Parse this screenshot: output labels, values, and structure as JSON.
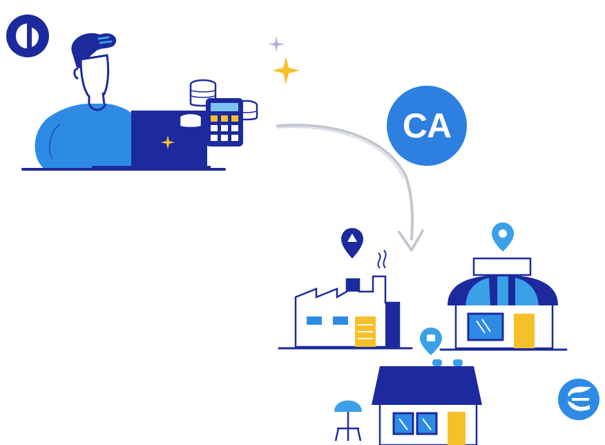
{
  "badge": {
    "text": "CA"
  },
  "colors": {
    "navy": "#1c2a9e",
    "blue": "#2d7fe0",
    "light_blue": "#3aa0e8",
    "yellow": "#f5c12b",
    "sparkle_purple": "#b9a8e8",
    "arrow_gray": "#c2c7cf"
  },
  "icons": [
    "brand-logo-top-left-icon",
    "person-at-laptop-illustration",
    "coins-stack-icon",
    "calculator-icon",
    "sparkle-star-icon",
    "curved-arrow-icon",
    "factory-illustration",
    "store-awning-illustration",
    "house-illustration",
    "location-pin-icon",
    "brand-logo-bottom-right-icon"
  ]
}
